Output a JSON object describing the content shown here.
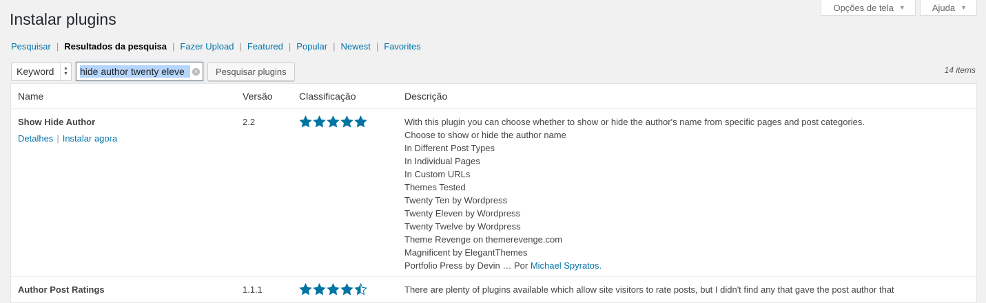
{
  "screen_meta": {
    "options_label": "Opções de tela",
    "help_label": "Ajuda"
  },
  "page_title": "Instalar plugins",
  "nav": {
    "items": [
      {
        "label": "Pesquisar",
        "current": false
      },
      {
        "label": "Resultados da pesquisa",
        "current": true
      },
      {
        "label": "Fazer Upload",
        "current": false
      },
      {
        "label": "Featured",
        "current": false
      },
      {
        "label": "Popular",
        "current": false
      },
      {
        "label": "Newest",
        "current": false
      },
      {
        "label": "Favorites",
        "current": false
      }
    ],
    "separator": "|"
  },
  "search": {
    "type_value": "Keyword",
    "query_value": "hide author twenty eleve",
    "button_label": "Pesquisar plugins",
    "items_count": "14 items"
  },
  "table": {
    "headers": {
      "name": "Name",
      "version": "Versão",
      "rating": "Classificação",
      "description": "Descrição"
    },
    "rows": [
      {
        "name": "Show Hide Author",
        "actions": [
          "Detalhes",
          "Instalar agora"
        ],
        "version": "2.2",
        "rating": 5,
        "description_lines": [
          "With this plugin you can choose whether to show or hide the author's name from specific pages and post categories.",
          "Choose to show or hide the author name",
          "In Different Post Types",
          "In Individual Pages",
          "In Custom URLs",
          "Themes Tested",
          "Twenty Ten by Wordpress",
          "Twenty Eleven by Wordpress",
          "Twenty Twelve by Wordpress",
          "Theme Revenge on themerevenge.com",
          "Magnificent by ElegantThemes",
          "Portfolio Press by Devin … Por"
        ],
        "author": "Michael Spyratos."
      },
      {
        "name": "Author Post Ratings",
        "version": "1.1.1",
        "rating": 4.5,
        "description_lines": [
          "There are plenty of plugins available which allow site visitors to rate posts, but I didn't find any that gave the post author that"
        ]
      }
    ]
  },
  "colors": {
    "accent": "#0073aa",
    "star": "#0074a2",
    "background": "#f1f1f1"
  }
}
